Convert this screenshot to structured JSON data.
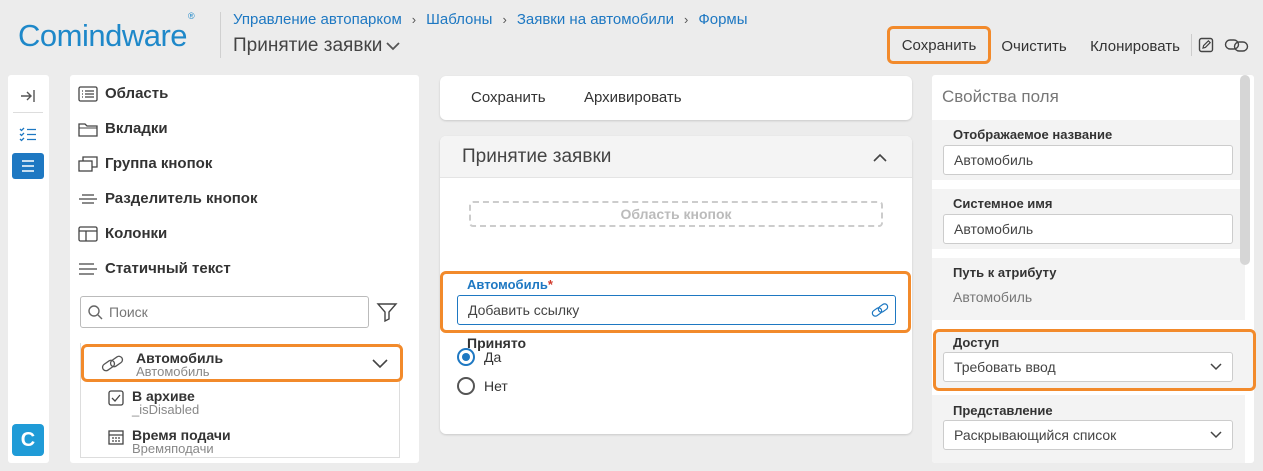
{
  "header": {
    "logo": "Comindware",
    "logo_mark": "®",
    "breadcrumbs": [
      "Управление автопарком",
      "Шаблоны",
      "Заявки на автомобили",
      "Формы"
    ],
    "breadcrumb_sep": "›",
    "title": "Принятие заявки",
    "toolbar": {
      "save": "Сохранить",
      "clear": "Очистить",
      "clone": "Клонировать"
    }
  },
  "toolbox": {
    "items": [
      "Область",
      "Вкладки",
      "Группа кнопок",
      "Разделитель кнопок",
      "Колонки",
      "Статичный текст"
    ],
    "search_placeholder": "Поиск",
    "attributes": [
      {
        "name": "Автомобиль",
        "sub": "Автомобиль"
      },
      {
        "name": "В архиве",
        "sub": "_isDisabled"
      },
      {
        "name": "Время подачи",
        "sub": "Времяподачи"
      }
    ]
  },
  "form": {
    "toolbar": {
      "save": "Сохранить",
      "archive": "Архивировать"
    },
    "card_title": "Принятие заявки",
    "button_area": "Область кнопок",
    "field_label": "Автомобиль",
    "required_mark": "*",
    "field_placeholder": "Добавить ссылку",
    "radio_label": "Принято",
    "radio_options": [
      "Да",
      "Нет"
    ],
    "radio_selected": "Да"
  },
  "properties": {
    "title": "Свойства поля",
    "display_name_label": "Отображаемое название",
    "display_name_value": "Автомобиль",
    "system_name_label": "Системное имя",
    "system_name_value": "Автомобиль",
    "path_label": "Путь к атрибуту",
    "path_value": "Автомобиль",
    "access_label": "Доступ",
    "access_value": "Требовать ввод",
    "view_label": "Представление",
    "view_value": "Раскрывающийся список"
  },
  "colors": {
    "accent": "#1e78c2",
    "highlight": "#f28a2b",
    "rail_active": "#1e78c2"
  }
}
